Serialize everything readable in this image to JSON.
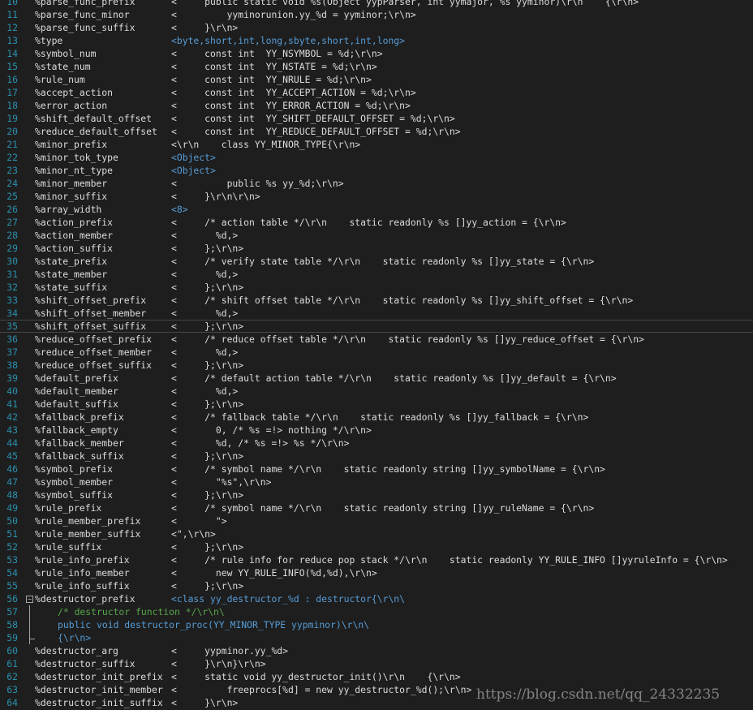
{
  "colors": {
    "background": "#1e1e1e",
    "line_number": "#2b91af",
    "text": "#dcdcdc",
    "keyword": "#569cd6",
    "comment": "#57a64a"
  },
  "lines": [
    {
      "n": "10",
      "k": "%parse_func_prefix",
      "v": "<     public static void %s(Object yypParser, int yymajor, %s yyminor)\\r\\n    {\\r\\n>"
    },
    {
      "n": "11",
      "k": "%parse_func_minor",
      "v": "<         yyminorunion.yy_%d = yyminor;\\r\\n>"
    },
    {
      "n": "12",
      "k": "%parse_func_suffix",
      "v": "<     }\\r\\n>"
    },
    {
      "n": "13",
      "k": "%type",
      "v": "<byte,short,int,long,sbyte,short,int,long>",
      "style": "blue"
    },
    {
      "n": "14",
      "k": "%symbol_num",
      "v": "<     const int  YY_NSYMBOL = %d;\\r\\n>"
    },
    {
      "n": "15",
      "k": "%state_num",
      "v": "<     const int  YY_NSTATE = %d;\\r\\n>"
    },
    {
      "n": "16",
      "k": "%rule_num",
      "v": "<     const int  YY_NRULE = %d;\\r\\n>"
    },
    {
      "n": "17",
      "k": "%accept_action",
      "v": "<     const int  YY_ACCEPT_ACTION = %d;\\r\\n>"
    },
    {
      "n": "18",
      "k": "%error_action",
      "v": "<     const int  YY_ERROR_ACTION = %d;\\r\\n>"
    },
    {
      "n": "19",
      "k": "%shift_default_offset",
      "v": "<     const int  YY_SHIFT_DEFAULT_OFFSET = %d;\\r\\n>"
    },
    {
      "n": "20",
      "k": "%reduce_default_offset",
      "v": "<     const int  YY_REDUCE_DEFAULT_OFFSET = %d;\\r\\n>"
    },
    {
      "n": "21",
      "k": "%minor_prefix",
      "v": "<\\r\\n    class YY_MINOR_TYPE{\\r\\n>"
    },
    {
      "n": "22",
      "k": "%minor_tok_type",
      "v": "<Object>",
      "style": "blue"
    },
    {
      "n": "23",
      "k": "%minor_nt_type",
      "v": "<Object>",
      "style": "blue"
    },
    {
      "n": "24",
      "k": "%minor_member",
      "v": "<         public %s yy_%d;\\r\\n>"
    },
    {
      "n": "25",
      "k": "%minor_suffix",
      "v": "<     }\\r\\n\\r\\n>"
    },
    {
      "n": "26",
      "k": "%array_width",
      "v": "<8>",
      "style": "blue"
    },
    {
      "n": "27",
      "k": "%action_prefix",
      "v": "<     /* action table */\\r\\n    static readonly %s []yy_action = {\\r\\n>"
    },
    {
      "n": "28",
      "k": "%action_member",
      "v": "<       %d,>"
    },
    {
      "n": "29",
      "k": "%action_suffix",
      "v": "<     };\\r\\n>"
    },
    {
      "n": "30",
      "k": "%state_prefix",
      "v": "<     /* verify state table */\\r\\n    static readonly %s []yy_state = {\\r\\n>"
    },
    {
      "n": "31",
      "k": "%state_member",
      "v": "<       %d,>"
    },
    {
      "n": "32",
      "k": "%state_suffix",
      "v": "<     };\\r\\n>"
    },
    {
      "n": "33",
      "k": "%shift_offset_prefix",
      "v": "<     /* shift offset table */\\r\\n    static readonly %s []yy_shift_offset = {\\r\\n>"
    },
    {
      "n": "34",
      "k": "%shift_offset_member",
      "v": "<       %d,>"
    },
    {
      "n": "35",
      "k": "%shift_offset_suffix",
      "v": "<     };\\r\\n>",
      "current": true
    },
    {
      "n": "36",
      "k": "%reduce_offset_prefix",
      "v": "<     /* reduce offset table */\\r\\n    static readonly %s []yy_reduce_offset = {\\r\\n>"
    },
    {
      "n": "37",
      "k": "%reduce_offset_member",
      "v": "<       %d,>"
    },
    {
      "n": "38",
      "k": "%reduce_offset_suffix",
      "v": "<     };\\r\\n>"
    },
    {
      "n": "39",
      "k": "%default_prefix",
      "v": "<     /* default action table */\\r\\n    static readonly %s []yy_default = {\\r\\n>"
    },
    {
      "n": "40",
      "k": "%default_member",
      "v": "<       %d,>"
    },
    {
      "n": "41",
      "k": "%default_suffix",
      "v": "<     };\\r\\n>"
    },
    {
      "n": "42",
      "k": "%fallback_prefix",
      "v": "<     /* fallback table */\\r\\n    static readonly %s []yy_fallback = {\\r\\n>"
    },
    {
      "n": "43",
      "k": "%fallback_empty",
      "v": "<       0, /* %s =!> nothing */\\r\\n>"
    },
    {
      "n": "44",
      "k": "%fallback_member",
      "v": "<       %d, /* %s =!> %s */\\r\\n>"
    },
    {
      "n": "45",
      "k": "%fallback_suffix",
      "v": "<     };\\r\\n>"
    },
    {
      "n": "46",
      "k": "%symbol_prefix",
      "v": "<     /* symbol name */\\r\\n    static readonly string []yy_symbolName = {\\r\\n>"
    },
    {
      "n": "47",
      "k": "%symbol_member",
      "v": "<       \"%s\",\\r\\n>"
    },
    {
      "n": "48",
      "k": "%symbol_suffix",
      "v": "<     };\\r\\n>"
    },
    {
      "n": "49",
      "k": "%rule_prefix",
      "v": "<     /* symbol name */\\r\\n    static readonly string []yy_ruleName = {\\r\\n>"
    },
    {
      "n": "50",
      "k": "%rule_member_prefix",
      "v": "<       \">"
    },
    {
      "n": "51",
      "k": "%rule_member_suffix",
      "v": "<\",\\r\\n>"
    },
    {
      "n": "52",
      "k": "%rule_suffix",
      "v": "<     };\\r\\n>"
    },
    {
      "n": "53",
      "k": "%rule_info_prefix",
      "v": "<     /* rule info for reduce pop stack */\\r\\n    static readonly YY_RULE_INFO []yyruleInfo = {\\r\\n>"
    },
    {
      "n": "54",
      "k": "%rule_info_member",
      "v": "<       new YY_RULE_INFO(%d,%d),\\r\\n>"
    },
    {
      "n": "55",
      "k": "%rule_info_suffix",
      "v": "<     };\\r\\n>"
    },
    {
      "n": "56",
      "k": "%destructor_prefix",
      "v": "<class yy_destructor_%d : destructor{\\r\\n\\",
      "style": "blue",
      "fold": "−"
    },
    {
      "n": "57",
      "code": "/* destructor function */\\r\\n\\",
      "style": "cm",
      "guide": "mid"
    },
    {
      "n": "58",
      "code": "public void destructor_proc(YY_MINOR_TYPE yypminor)\\r\\n\\",
      "style": "kw",
      "guide": "mid"
    },
    {
      "n": "59",
      "code": "{\\r\\n>",
      "style": "kw",
      "guide": "end"
    },
    {
      "n": "60",
      "k": "%destructor_arg",
      "v": "<     yypminor.yy_%d>"
    },
    {
      "n": "61",
      "k": "%destructor_suffix",
      "v": "<     }\\r\\n}\\r\\n>"
    },
    {
      "n": "62",
      "k": "%destructor_init_prefix",
      "v": "<     static void yy_destructor_init()\\r\\n    {\\r\\n>"
    },
    {
      "n": "63",
      "k": "%destructor_init_member",
      "v": "<         freeprocs[%d] = new yy_destructor_%d();\\r\\n>"
    },
    {
      "n": "64",
      "k": "%destructor_init_suffix",
      "v": "<     }\\r\\n>"
    }
  ],
  "watermark": "https://blog.csdn.net/qq_24332235"
}
